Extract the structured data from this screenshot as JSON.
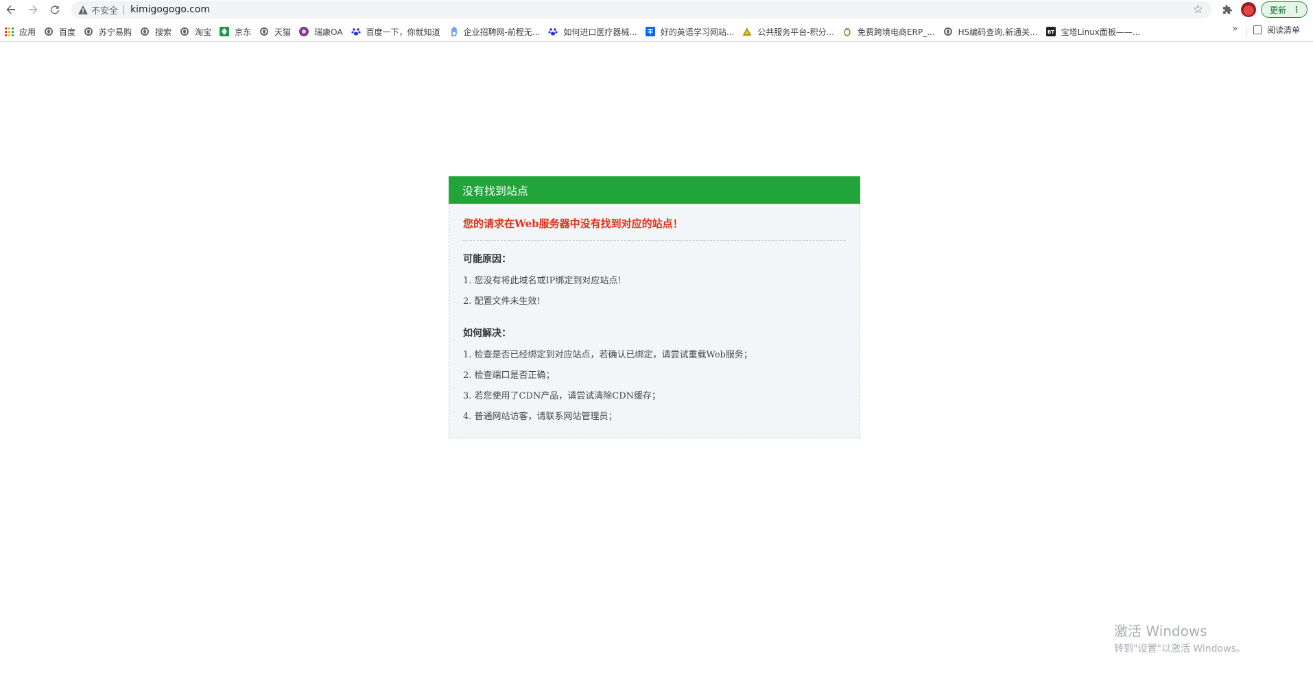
{
  "omnibox": {
    "security_label": "不安全",
    "url": "kimigogogo.com"
  },
  "toolbar": {
    "update_label": "更新",
    "dots": "⋮"
  },
  "bookmarks": {
    "items": [
      {
        "label": "应用",
        "icon": "apps-grid-icon"
      },
      {
        "label": "百度",
        "icon": "globe-icon"
      },
      {
        "label": "苏宁易购",
        "icon": "globe-icon"
      },
      {
        "label": "搜索",
        "icon": "globe-icon"
      },
      {
        "label": "淘宝",
        "icon": "globe-icon"
      },
      {
        "label": "京东",
        "icon": "puzzle-green-icon"
      },
      {
        "label": "天猫",
        "icon": "globe-icon"
      },
      {
        "label": "瑞康OA",
        "icon": "ruikang-icon"
      },
      {
        "label": "百度一下，你就知道",
        "icon": "baidu-paw-icon"
      },
      {
        "label": "企业招聘网-前程无...",
        "icon": "hand-icon"
      },
      {
        "label": "如何进口医疗器械...",
        "icon": "baidu-paw-icon"
      },
      {
        "label": "好的英语学习网站...",
        "icon": "zhihu-icon"
      },
      {
        "label": "公共服务平台-积分...",
        "icon": "triangle-icon"
      },
      {
        "label": "免费跨境电商ERP_...",
        "icon": "egg-icon"
      },
      {
        "label": "HS编码查询,新通关...",
        "icon": "globe-icon"
      },
      {
        "label": "宝塔Linux面板——...",
        "icon": "bt-icon"
      }
    ],
    "more": "»",
    "reading_list": "阅读清单"
  },
  "error": {
    "header": "没有找到站点",
    "message": "您的请求在Web服务器中没有找到对应的站点！",
    "reasons_title": "可能原因：",
    "reasons": [
      "1. 您没有将此域名或IP绑定到对应站点!",
      "2. 配置文件未生效!"
    ],
    "solutions_title": "如何解决：",
    "solutions": [
      "1. 检查是否已经绑定到对应站点，若确认已绑定，请尝试重载Web服务；",
      "2. 检查端口是否正确；",
      "3. 若您使用了CDN产品，请尝试清除CDN缓存；",
      "4. 普通网站访客，请联系网站管理员；"
    ]
  },
  "watermark": {
    "line1": "激活 Windows",
    "line2": "转到\"设置\"以激活 Windows。"
  },
  "colors": {
    "header_green": "#21a43a",
    "error_red": "#e0311b",
    "update_green": "#137333"
  }
}
